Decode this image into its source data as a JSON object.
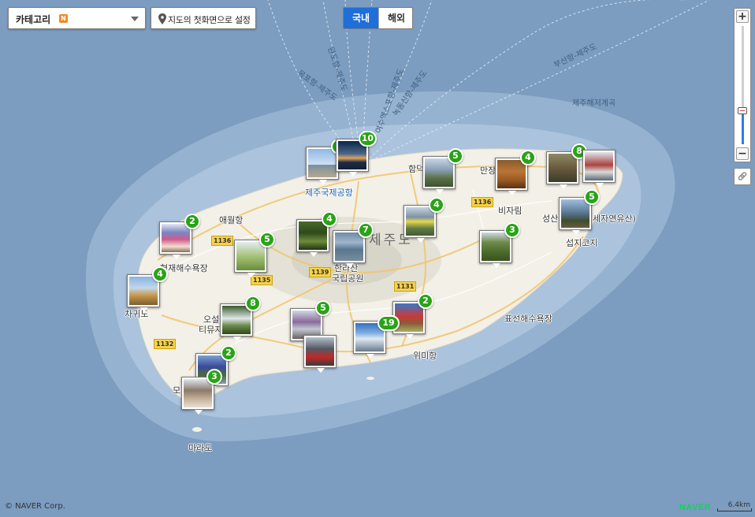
{
  "toolbar": {
    "category_label": "카테고리",
    "new_badge": "N",
    "reset_label": "지도의 첫화면으로 설정"
  },
  "tabs": {
    "domestic": "국내",
    "overseas": "해외"
  },
  "zoom": {
    "plus": "+",
    "minus": "−"
  },
  "footer": {
    "copyright": "© NAVER Corp.",
    "brand": "NAVER",
    "scale": "6.4km"
  },
  "places": {
    "airport": "제주국제공항",
    "aewol": "애월항",
    "hyeopjae": "협재해수욕장",
    "chagwido": "차귀도",
    "hallasan": "한라산",
    "national_park": "국립공원",
    "jejudo": "제주도",
    "bijarim": "비자림",
    "manjang": "만장",
    "hamdeok": "함덕",
    "seongsan": "성산",
    "seongsan_suffix": "세자연유산)",
    "seopjikoji": "섭지코지",
    "pyoseon": "표선해수욕장",
    "wimi": "위미항",
    "marado": "마라도",
    "oseol": "오설",
    "tiyu": "티뮤지",
    "mo": "모",
    "sea_label": "제주해저계곡",
    "route_mokpo": "목포항-제주도",
    "route_yeosu": "여수엑스포항-제주도",
    "route_busan": "부산항-제주도",
    "route_wando": "완도항-제주도",
    "route_nokdong": "녹동신항-제주도",
    "route_goheung": "고흥항-제주도"
  },
  "roads": [
    "1136",
    "1136",
    "1139",
    "1135",
    "1131",
    "1132"
  ],
  "markers": [
    {
      "count": "4"
    },
    {
      "count": "10"
    },
    {
      "count": "5"
    },
    {
      "count": "4"
    },
    {
      "count": "8"
    },
    {
      "count": ""
    },
    {
      "count": "5"
    },
    {
      "count": "4"
    },
    {
      "count": "3"
    },
    {
      "count": "2"
    },
    {
      "count": "5"
    },
    {
      "count": "4"
    },
    {
      "count": "7"
    },
    {
      "count": "4"
    },
    {
      "count": "8"
    },
    {
      "count": "5"
    },
    {
      "count": ""
    },
    {
      "count": "2"
    },
    {
      "count": "19"
    },
    {
      "count": "2"
    },
    {
      "count": "3"
    }
  ],
  "colors": {
    "sea": "#7f9fc1",
    "land": "#f3f0e8",
    "badge": "#2aa317",
    "tab_active": "#1e6fd9",
    "brand": "#19ce60"
  }
}
